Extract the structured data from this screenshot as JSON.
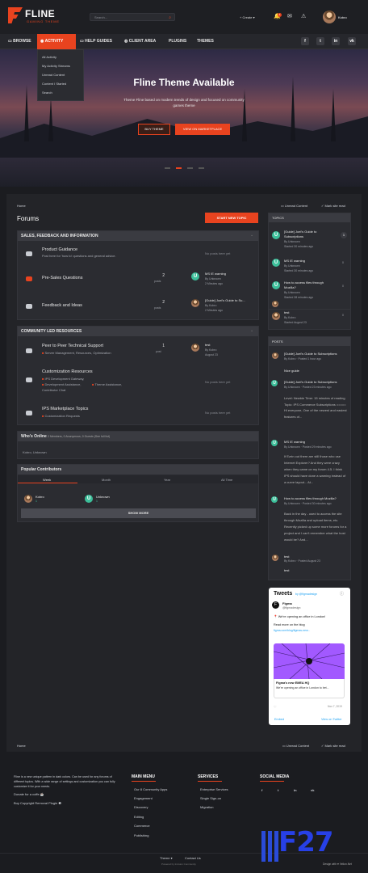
{
  "header": {
    "logo": "FLINE",
    "logo_sub": "GAMING THEME",
    "search_placeholder": "Search...",
    "create": "Create",
    "badge": "1",
    "user": "Kobro"
  },
  "nav": {
    "items": [
      "BROWSE",
      "ACTIVITY",
      "HELP GUIDES",
      "CLIENT AREA",
      "PLUGINS",
      "THEMES"
    ],
    "dropdown": [
      "All Activity",
      "My Activity Streams",
      "Unread Content",
      "Content I Started",
      "Search"
    ],
    "social": [
      "f",
      "t",
      "in",
      "vk"
    ]
  },
  "hero": {
    "title": "Fline Theme Available",
    "subtitle": "Theme Fline based on modern trends of design and focused on community games theme",
    "btn1": "BUY THEME",
    "btn2": "VIEW ON MARKETPLACE"
  },
  "crumb": {
    "home": "Home",
    "unread": "Unread Content",
    "mark": "Mark site read"
  },
  "forums": {
    "title": "Forums",
    "new_topic": "START NEW TOPIC",
    "cat1": "SALES, FEEDBACK AND INFORMATION",
    "cat2": "COMMUNITY LED RESOURCES",
    "rows": [
      {
        "title": "Product Guidance",
        "desc": "Post here for 'how to' questions and general advice.",
        "nopost": "No posts here yet"
      },
      {
        "title": "Pre-Sales Questions",
        "count": "2",
        "unit": "posts",
        "last": "MS IE warning",
        "by": "By Unknown",
        "time": "2 Minutes ago"
      },
      {
        "title": "Feedback and Ideas",
        "count": "2",
        "unit": "posts",
        "last": "[Guide] Joel's Guide to Su...",
        "by": "By Kobro",
        "time": "2 Minutes ago"
      },
      {
        "title": "Peer to Peer Technical Support",
        "sub": "Server Management, Resources, Optimization",
        "count": "1",
        "unit": "post",
        "last": "test",
        "by": "By Kobro",
        "time": "August 23"
      },
      {
        "title": "Customization Resources",
        "sub1": "IPS Development Gateway,",
        "sub2": "Development Assistance,",
        "sub3": "Theme Assistance,",
        "sub4": "Contributor Chat",
        "nopost": "No posts here yet"
      },
      {
        "title": "IPS Marketplace Topics",
        "sub": "Customization Requests",
        "nopost": "No posts here yet"
      }
    ]
  },
  "online": {
    "title": "Who's Online",
    "meta": "2 Members, 0 Anonymous, 0 Guests (See full list)",
    "users": "Kobro, Unknown"
  },
  "contrib": {
    "title": "Popular Contributors",
    "tabs": [
      "Week",
      "Month",
      "Year",
      "All Time"
    ],
    "u1": "Kobro",
    "u2": "Unknown",
    "r1": "1",
    "r2": "1",
    "more": "SHOW MORE"
  },
  "topics": {
    "title": "TOPICS",
    "items": [
      {
        "t": "[Guide] Joel's Guide to Subscriptions",
        "by": "By Unknown",
        "d": "Started 30 minutes ago",
        "n": "1"
      },
      {
        "t": "MS IE warning",
        "by": "By Unknown",
        "d": "Started 30 minutes ago",
        "n": "0"
      },
      {
        "t": "How to access files through Mozilla?",
        "by": "By Unknown",
        "d": "Started 38 minutes ago",
        "n": "0"
      },
      {
        "t": "test",
        "by": "By Kobro",
        "d": "Started August 23",
        "n": "0"
      }
    ]
  },
  "posts": {
    "title": "POSTS",
    "items": [
      {
        "t": "[Guide] Joel's Guide to Subscriptions",
        "m": "By Kobro · Posted 1 hour ago",
        "b": "Nice guide"
      },
      {
        "t": "[Guide] Joel's Guide to Subscriptions",
        "m": "By Unknown · Posted 23 minutes ago",
        "b": "Level: Newbie Time: 15 minutes of reading Topic: IPS Commerce Subscriptions ===== Hi everyone, One of the newest and easiest features of..."
      },
      {
        "t": "MS IE warning",
        "m": "By Unknown · Posted 29 minutes ago",
        "b": "If Ezrin out there are still those who use Internet Explorer? And they were crazy when they came on my forum 4.5. I think IPS should have done a warning instead of a curve layout... At..."
      },
      {
        "t": "How to access files through Mozilla?",
        "m": "By Unknown · Posted 30 minutes ago",
        "b": "Back in the day - used to access the site through Mozilla and upload items, etc. Recently picked up some more forums for a project and I can't remember what the host would be? And..."
      },
      {
        "t": "test",
        "m": "By Kobro · Posted August 23",
        "b": "test"
      }
    ]
  },
  "tweets": {
    "title": "Tweets",
    "by": "by @figmadesign",
    "name": "Figma",
    "handle": "@figmadesign",
    "line1": "We're opening an office in London!",
    "line2": "Read more on the blog",
    "link": "figma.com/blog/figmas-new...",
    "card_t": "Figma's new EMEA HQ",
    "card_s": "We're opening an office in London to bet...",
    "date": "Nov 7, 2019",
    "embed": "Embed",
    "view": "View on Twitter"
  },
  "footer": {
    "about": "Fline is a new unique pattern in dark colors. Can be used for any forums of different topics. With a wide range of settings and customization you can fully customize it for your needs.",
    "coffee": "Donate for a coffe",
    "copyright": "Buy Copyright Removal Plugin",
    "menu_title": "MAIN MENU",
    "menu": [
      "Our 8 Community Apps",
      "Engagement",
      "Discovery",
      "Editing",
      "Commerce",
      "Publishing"
    ],
    "svc_title": "SERVICES",
    "svc": [
      "Enterprise Services",
      "Single Sign-on",
      "Migration"
    ],
    "soc_title": "SOCIAL MEDIA",
    "theme": "Theme",
    "contact": "Contact Us",
    "powered": "Powered by Invision Community",
    "design": "Design with ♥ Velion.Net"
  },
  "watermark": "F27"
}
